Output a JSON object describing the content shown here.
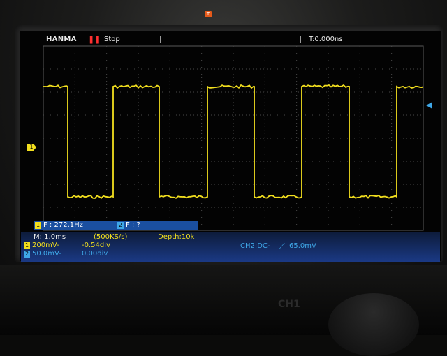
{
  "header": {
    "brand": "HANMA",
    "run_icon": "stop-icon",
    "run_state": "Stop",
    "time_offset": "T:0.000ns"
  },
  "measurement": {
    "ch1_tag": "1",
    "ch1_text": "F : 272.1Hz",
    "ch2_tag": "2",
    "ch2_text": "F :    ?"
  },
  "status": {
    "timebase": "M: 1.0ms",
    "sample_rate": "(500KS/s)",
    "depth": "Depth:10k",
    "ch1_tag": "1",
    "ch1_volts": "200mV-",
    "ch1_offset": "-0.54div",
    "ch2_tag": "2",
    "ch2_volts": "50.0mV-",
    "ch2_offset": "0.00div",
    "trigger_source": "CH2:DC-",
    "trigger_edge_icon": "rising-edge-icon",
    "trigger_level": "65.0mV"
  },
  "markers": {
    "ch1_marker": "1",
    "trigger_pos_marker": "T"
  },
  "device": {
    "model_label": "CH1"
  },
  "colors": {
    "ch1": "#f2df1e",
    "ch2": "#3fa8e8",
    "grid": "#4a4a4a",
    "info_bar": "#1b3a86",
    "stop": "#ff3030"
  },
  "waveform": {
    "channel": "CH1",
    "shape": "square",
    "frequency_hz": 272.1,
    "duty_cycle": 0.5
  }
}
